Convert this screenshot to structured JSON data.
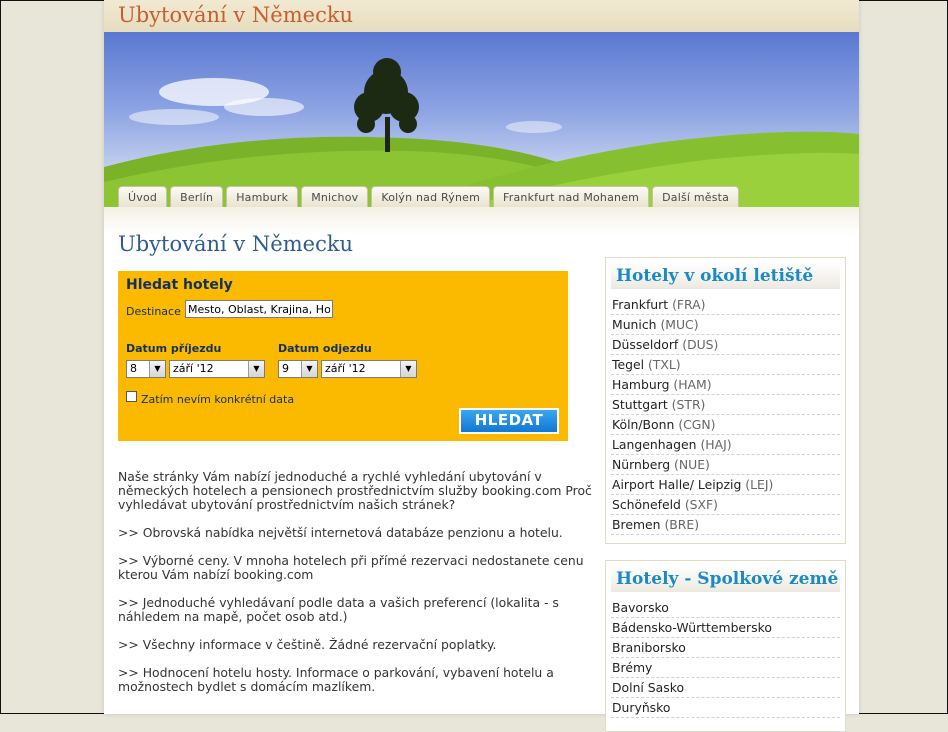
{
  "site": {
    "title": "Ubytování v Německu"
  },
  "nav": {
    "tabs": [
      "Úvod",
      "Berlín",
      "Hamburk",
      "Mnichov",
      "Kolýn nad Rýnem",
      "Frankfurt nad Mohanem",
      "Další města"
    ]
  },
  "main": {
    "heading": "Ubytování v Německu"
  },
  "search": {
    "title": "Hledat hotely",
    "destination_label": "Destinace",
    "destination_value": "Mesto, Oblast, Krajina, Ho",
    "arrival_label": "Datum příjezdu",
    "departure_label": "Datum odjezdu",
    "arrival_day": "8",
    "arrival_month": "září '12",
    "departure_day": "9",
    "departure_month": "září '12",
    "no_date_label": "Zatím nevím konkrétní data",
    "button_label": "HLEDAT"
  },
  "intro": {
    "paragraphs": [
      "Naše stránky Vám nabízí jednoduché a rychlé vyhledání ubytování v německých hotelech a pensionech prostřednictvím služby booking.com Proč vyhledávat ubytování prostřednictvím našich stránek?",
      ">> Obrovská nabídka největší internetová databáze penzionu a hotelu.",
      ">> Výborné ceny.  V mnoha hotelech při přímé rezervaci nedostanete cenu kterou Vám nabízí booking.com",
      ">> Jednoduché vyhledávaní podle data a vašich preferencí (lokalita - s náhledem na mapě, počet osob atd.)",
      ">> Všechny informace v češtině. Žádné rezervační poplatky.",
      ">> Hodnocení hotelu hosty. Informace o parkování, vybavení hotelu a možnostech bydlet s domácím mazlíkem."
    ]
  },
  "airports": {
    "title": "Hotely v okolí letiště",
    "items": [
      {
        "name": "Frankfurt",
        "code": "(FRA)"
      },
      {
        "name": "Munich",
        "code": "(MUC)"
      },
      {
        "name": "Düsseldorf",
        "code": "(DUS)"
      },
      {
        "name": "Tegel",
        "code": "(TXL)"
      },
      {
        "name": "Hamburg",
        "code": "(HAM)"
      },
      {
        "name": "Stuttgart",
        "code": "(STR)"
      },
      {
        "name": "Köln/Bonn",
        "code": "(CGN)"
      },
      {
        "name": "Langenhagen",
        "code": "(HAJ)"
      },
      {
        "name": "Nürnberg",
        "code": "(NUE)"
      },
      {
        "name": "Airport Halle/ Leipzig",
        "code": "(LEJ)"
      },
      {
        "name": "Schönefeld",
        "code": "(SXF)"
      },
      {
        "name": "Bremen",
        "code": "(BRE)"
      }
    ]
  },
  "states": {
    "title": "Hotely - Spolkové země",
    "items": [
      "Bavorsko",
      "Bádensko-Württembersko",
      "Braniborsko",
      "Brémy",
      "Dolní Sasko",
      "Duryňsko"
    ]
  },
  "colors": {
    "title_orange": "#c75e2e",
    "heading_blue": "#2f5c8f",
    "search_box": "#fbb900",
    "button_blue": "#1277d3",
    "sidebar_title": "#1a8ac4"
  }
}
